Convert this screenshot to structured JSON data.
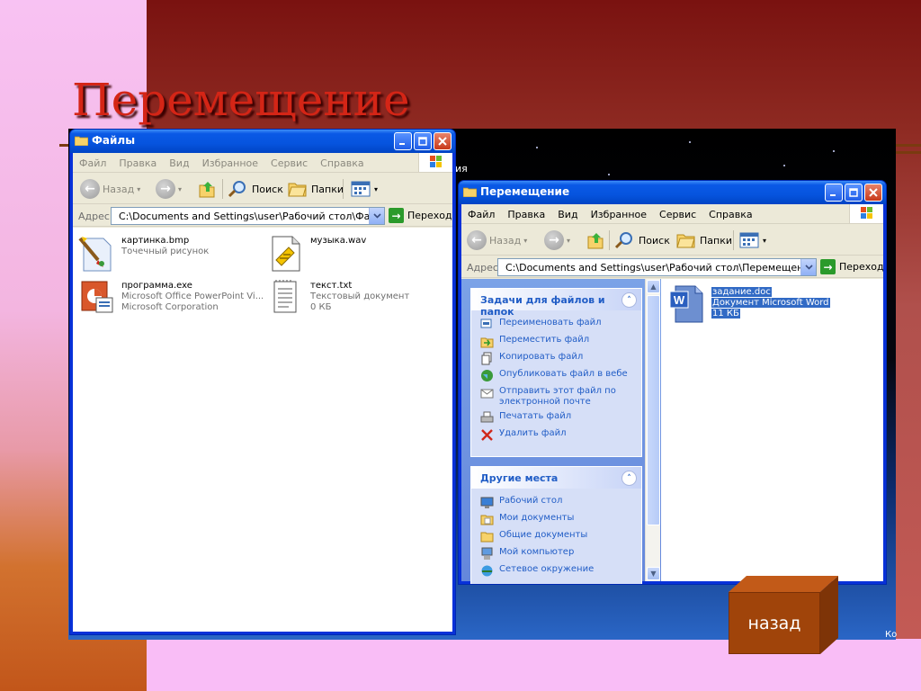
{
  "slide": {
    "title": "Перемещение",
    "back_label": "назад"
  },
  "desktop": {
    "stray_text": "ия",
    "corner_text": "Ко"
  },
  "window_files": {
    "title": "Файлы",
    "menu": [
      "Файл",
      "Правка",
      "Вид",
      "Избранное",
      "Сервис",
      "Справка"
    ],
    "toolbar": {
      "back": "Назад",
      "search": "Поиск",
      "folders": "Папки"
    },
    "address_label": "Адрес:",
    "address": "C:\\Documents and Settings\\user\\Рабочий стол\\Файлы",
    "go_label": "Переход",
    "files": [
      {
        "name": "картинка.bmp",
        "line2": "Точечный рисунок",
        "line3": "",
        "icon": "paint-bitmap-icon"
      },
      {
        "name": "музыка.wav",
        "line2": "",
        "line3": "",
        "icon": "wave-audio-icon"
      },
      {
        "name": "программа.exe",
        "line2": "Microsoft Office PowerPoint Vi...",
        "line3": "Microsoft Corporation",
        "icon": "powerpoint-icon"
      },
      {
        "name": "текст.txt",
        "line2": "Текстовый документ",
        "line3": "0 КБ",
        "icon": "text-document-icon"
      }
    ]
  },
  "window_move": {
    "title": "Перемещение",
    "menu": [
      "Файл",
      "Правка",
      "Вид",
      "Избранное",
      "Сервис",
      "Справка"
    ],
    "toolbar": {
      "back": "Назад",
      "search": "Поиск",
      "folders": "Папки"
    },
    "address_label": "Адрес:",
    "address": "C:\\Documents and Settings\\user\\Рабочий стол\\Перемещение",
    "go_label": "Переход",
    "tasks_header": "Задачи для файлов и папок",
    "tasks": [
      {
        "label": "Переименовать файл",
        "icon": "rename-icon"
      },
      {
        "label": "Переместить файл",
        "icon": "move-icon"
      },
      {
        "label": "Копировать файл",
        "icon": "copy-icon"
      },
      {
        "label": "Опубликовать файл в вебе",
        "icon": "web-publish-icon"
      },
      {
        "label": "Отправить этот файл по электронной почте",
        "icon": "email-icon"
      },
      {
        "label": "Печатать файл",
        "icon": "print-icon"
      },
      {
        "label": "Удалить файл",
        "icon": "delete-icon"
      }
    ],
    "places_header": "Другие места",
    "places": [
      {
        "label": "Рабочий стол",
        "icon": "desktop-icon"
      },
      {
        "label": "Мои документы",
        "icon": "my-documents-icon"
      },
      {
        "label": "Общие документы",
        "icon": "shared-documents-icon"
      },
      {
        "label": "Мой компьютер",
        "icon": "my-computer-icon"
      },
      {
        "label": "Сетевое окружение",
        "icon": "network-icon"
      }
    ],
    "file": {
      "name": "задание.doc",
      "line2": "Документ Microsoft Word",
      "line3": "11 КБ",
      "icon": "word-document-icon"
    }
  },
  "colors": {
    "slide_title": "#d42516",
    "back_button": "#a0440a",
    "xp_blue": "#0a59e6",
    "task_link": "#215dc6"
  }
}
